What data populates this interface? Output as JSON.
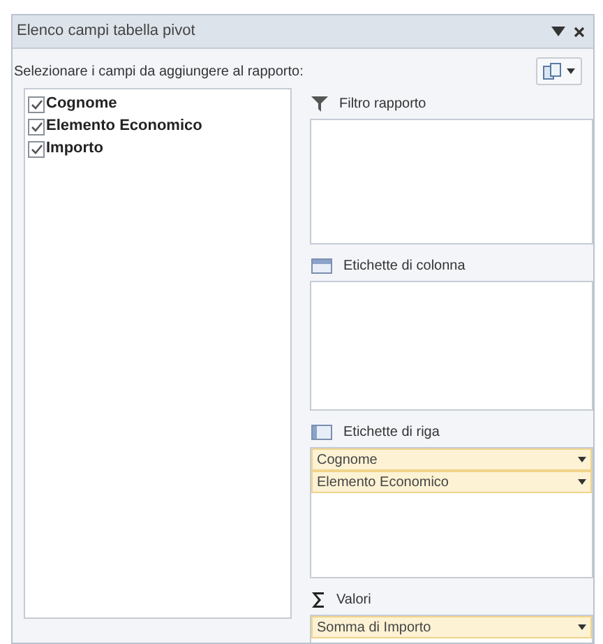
{
  "window": {
    "title": "Elenco campi tabella pivot"
  },
  "instruction": "Selezionare i campi da aggiungere al rapporto:",
  "fields": [
    {
      "label": "Cognome",
      "checked": true
    },
    {
      "label": "Elemento Economico",
      "checked": true
    },
    {
      "label": "Importo",
      "checked": true
    }
  ],
  "areas": [
    {
      "kind": "filter",
      "label": "Filtro rapporto"
    },
    {
      "kind": "columns",
      "label": "Etichette di colonna"
    },
    {
      "kind": "rows",
      "label": "Etichette di riga",
      "items": [
        "Cognome",
        "Elemento Economico"
      ]
    },
    {
      "kind": "values",
      "label": "Valori",
      "items": [
        "Somma di Importo"
      ]
    }
  ]
}
